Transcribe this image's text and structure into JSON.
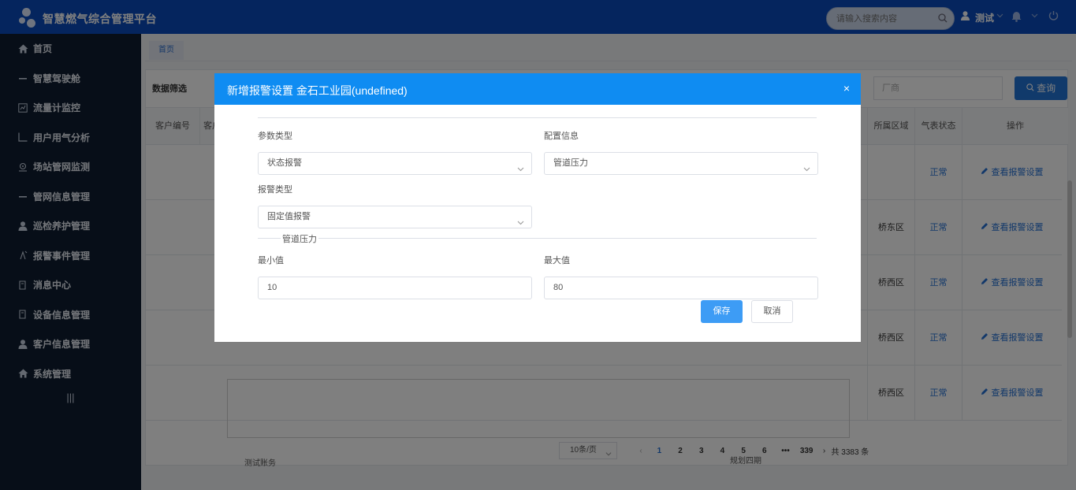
{
  "app": {
    "title": "智慧燃气综合管理平台"
  },
  "header": {
    "search_placeholder": "请输入搜索内容",
    "user": "测试"
  },
  "sidebar": {
    "items": [
      {
        "label": "首页",
        "icon": "home-icon"
      },
      {
        "label": "智慧驾驶舱",
        "icon": "dash-icon"
      },
      {
        "label": "流量计监控",
        "icon": "flowmeter-icon"
      },
      {
        "label": "用户用气分析",
        "icon": "chart-axis-icon"
      },
      {
        "label": "场站管网监测",
        "icon": "monitor-icon"
      },
      {
        "label": "管网信息管理",
        "icon": "dash-icon"
      },
      {
        "label": "巡检养护管理",
        "icon": "user-icon"
      },
      {
        "label": "报警事件管理",
        "icon": "alarm-icon"
      },
      {
        "label": "消息中心",
        "icon": "document-icon"
      },
      {
        "label": "设备信息管理",
        "icon": "document-icon"
      },
      {
        "label": "客户信息管理",
        "icon": "user-icon"
      },
      {
        "label": "系统管理",
        "icon": "home-icon"
      }
    ],
    "collapse_label": "|||"
  },
  "tabs": [
    {
      "label": "首页"
    }
  ],
  "filter": {
    "label": "数据筛选",
    "factory_placeholder": "厂商",
    "query_label": "查询"
  },
  "table": {
    "headers": [
      "客户编号",
      "客户",
      "所属区域",
      "气表状态",
      "操作"
    ],
    "rows": [
      {
        "area": "",
        "status": "正常",
        "action": "查看报警设置"
      },
      {
        "area": "桥东区",
        "status": "正常",
        "action": "查看报警设置"
      },
      {
        "area": "桥西区",
        "status": "正常",
        "action": "查看报警设置"
      },
      {
        "area": "桥西区",
        "status": "正常",
        "action": "查看报警设置"
      },
      {
        "area": "桥西区",
        "status": "正常",
        "action": "查看报警设置"
      }
    ],
    "partial_text": [
      "测试账务",
      "规划四期"
    ]
  },
  "pagination": {
    "page_size": "10条/页",
    "pages": [
      "1",
      "2",
      "3",
      "4",
      "5",
      "6",
      "•••",
      "339"
    ],
    "current": "1",
    "total": "共 3383 条"
  },
  "modal": {
    "title": "新增报警设置 金石工业园(undefined)",
    "close": "×",
    "param_type_label": "参数类型",
    "param_type_value": "状态报警",
    "config_label": "配置信息",
    "config_value": "管道压力",
    "alarm_type_label": "报警类型",
    "alarm_type_value": "固定值报警",
    "section_title": "管道压力",
    "min_label": "最小值",
    "min_value": "10",
    "max_label": "最大值",
    "max_value": "80",
    "save_label": "保存",
    "cancel_label": "取消"
  },
  "colors": {
    "header_bg": "#0a4bbd",
    "sidebar_bg": "#0e1d30",
    "accent": "#2274d6",
    "modal_head": "#0f8cf2"
  }
}
